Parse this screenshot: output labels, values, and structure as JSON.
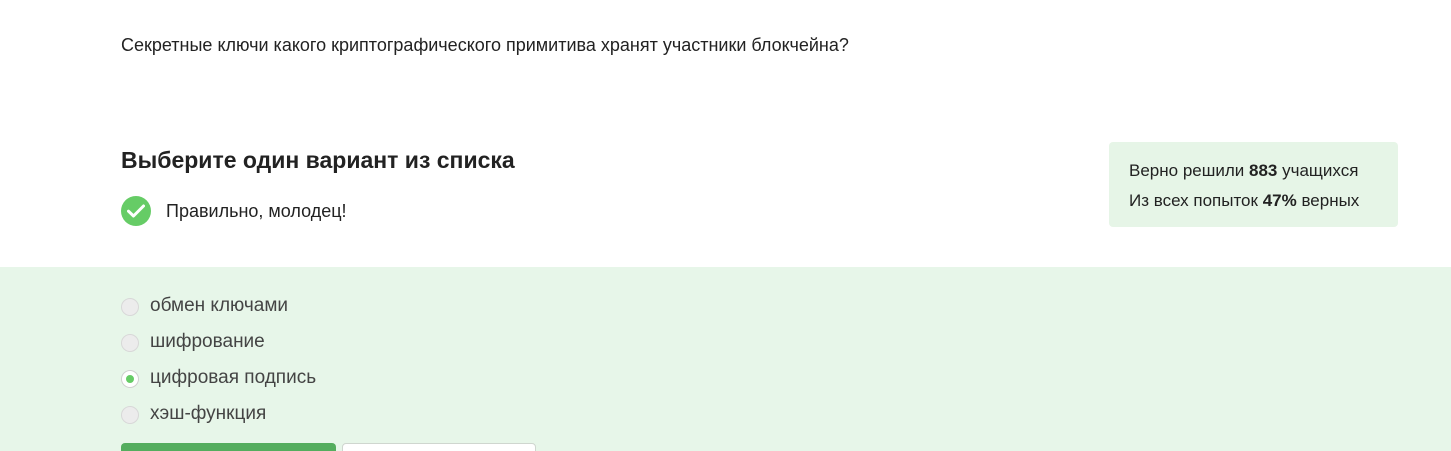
{
  "question": {
    "text": "Секретные ключи какого криптографического примитива хранят участники блокчейна?"
  },
  "task": {
    "heading": "Выберите один вариант из списка",
    "feedback_icon": "check-circle-icon",
    "feedback_text": "Правильно, молодец!"
  },
  "stats": {
    "solved_prefix": "Верно решили ",
    "solved_count": "883",
    "solved_suffix": " учащихся",
    "attempts_prefix": "Из всех попыток ",
    "attempts_percent": "47%",
    "attempts_suffix": " верных"
  },
  "options": [
    {
      "label": "обмен ключами",
      "selected": false
    },
    {
      "label": "шифрование",
      "selected": false
    },
    {
      "label": "цифровая подпись",
      "selected": true
    },
    {
      "label": "хэш-функция",
      "selected": false
    }
  ],
  "colors": {
    "accent": "#66cc66",
    "answer_background": "#e7f6e9",
    "stats_background": "#e6f5e7",
    "button_primary": "#54ad5e"
  }
}
